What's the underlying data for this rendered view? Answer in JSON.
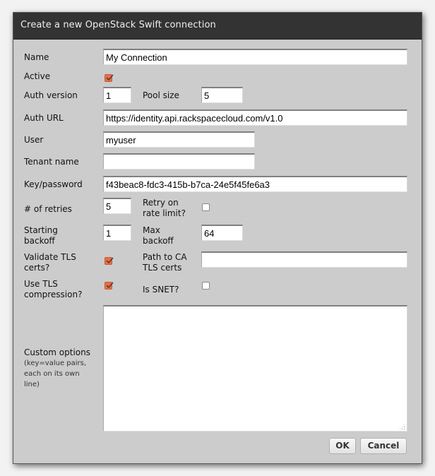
{
  "dialog": {
    "title": "Create a new OpenStack Swift connection"
  },
  "form": {
    "name": {
      "label": "Name",
      "value": "My Connection"
    },
    "active": {
      "label": "Active",
      "checked": true
    },
    "auth_version": {
      "label": "Auth version",
      "value": "1"
    },
    "pool_size": {
      "label": "Pool size",
      "value": "5"
    },
    "auth_url": {
      "label": "Auth URL",
      "value": "https://identity.api.rackspacecloud.com/v1.0"
    },
    "user": {
      "label": "User",
      "value": "myuser"
    },
    "tenant_name": {
      "label": "Tenant name",
      "value": ""
    },
    "key_password": {
      "label": "Key/password",
      "value": "f43beac8-fdc3-415b-b7ca-24e5f45fe6a3"
    },
    "retries": {
      "label": "# of retries",
      "value": "5"
    },
    "retry_on_rate_limit": {
      "label_line1": "Retry on",
      "label_line2": "rate limit?",
      "checked": false
    },
    "starting_backoff": {
      "label_line1": "Starting",
      "label_line2": "backoff",
      "value": "1"
    },
    "max_backoff": {
      "label_line1": "Max",
      "label_line2": "backoff",
      "value": "64"
    },
    "validate_tls": {
      "label_line1": "Validate TLS",
      "label_line2": "certs?",
      "checked": true
    },
    "ca_path": {
      "label_line1": "Path to CA",
      "label_line2": "TLS certs",
      "value": ""
    },
    "tls_compression": {
      "label_line1": "Use TLS",
      "label_line2": "compression?",
      "checked": true
    },
    "is_snet": {
      "label": "Is SNET?",
      "checked": false
    },
    "custom_options": {
      "label": "Custom options",
      "hint_line1": "(key=value pairs,",
      "hint_line2": "each on its own",
      "hint_line3": "line)",
      "value": ""
    }
  },
  "buttons": {
    "ok": "OK",
    "cancel": "Cancel"
  },
  "colors": {
    "checkbox_checked": "#e8704a",
    "titlebar": "#333333",
    "dialog_bg": "#cccccc"
  }
}
